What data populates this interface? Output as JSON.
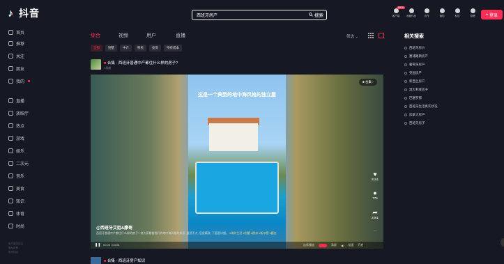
{
  "app": {
    "logo_text": "抖音"
  },
  "search": {
    "value": "西班牙房产",
    "button": "搜索"
  },
  "toolbar": {
    "items": [
      {
        "label": "客户端",
        "badge": "NEW"
      },
      {
        "label": "收藏作品"
      },
      {
        "label": "合作"
      },
      {
        "label": "通知"
      },
      {
        "label": "私信"
      },
      {
        "label": "投稿"
      }
    ],
    "login": "登录"
  },
  "sidebar": {
    "items": [
      {
        "label": "首页",
        "icon": "home-icon"
      },
      {
        "label": "推荐",
        "icon": "recommend-icon"
      },
      {
        "label": "关注",
        "icon": "follow-icon"
      },
      {
        "label": "朋友",
        "icon": "friends-icon"
      },
      {
        "label": "我的",
        "icon": "user-icon"
      },
      {
        "label": "直播",
        "icon": "live-icon"
      },
      {
        "label": "放映厅",
        "icon": "theater-icon"
      },
      {
        "label": "热点",
        "icon": "hot-icon"
      },
      {
        "label": "游戏",
        "icon": "game-icon"
      },
      {
        "label": "娱乐",
        "icon": "entertainment-icon"
      },
      {
        "label": "二次元",
        "icon": "anime-icon"
      },
      {
        "label": "音乐",
        "icon": "music-icon"
      },
      {
        "label": "美食",
        "icon": "food-icon"
      },
      {
        "label": "知识",
        "icon": "knowledge-icon"
      },
      {
        "label": "体育",
        "icon": "sports-icon"
      },
      {
        "label": "时尚",
        "icon": "fashion-icon"
      }
    ],
    "footer": [
      "用户服务协议",
      "隐私政策",
      "账号找回"
    ]
  },
  "tabs": [
    "综合",
    "视频",
    "用户",
    "直播"
  ],
  "filter_label": "筛选",
  "chips": [
    "全部",
    "别墅",
    "中介",
    "移民",
    "投资",
    "持有成本"
  ],
  "post": {
    "title": "合集 · 西班牙普通中产都住什么样的房子?",
    "date": "7月前",
    "overlay_text": "这是一个典型的地中海风格的独立屋",
    "collection": "合集",
    "author": "@西班牙艾姐&摩哥",
    "description": "西班牙普通中产都住什么样的房子? 带大家看看我们的地中海风格的新家, 虽然不大, 但很精致, 下面是详细。",
    "tags": [
      "#海外生活",
      "#别墅",
      "#欧洲",
      "#新冰雪",
      "#露台"
    ],
    "likes": "9151",
    "comments": "775",
    "shares": "2461",
    "more": "...",
    "time": "00:00 / 04:08",
    "controls": [
      "连续播放",
      "清屏",
      "倍速",
      "开启"
    ]
  },
  "next_post": {
    "title": "合集 · 西班牙房产知识"
  },
  "related": {
    "title": "相关搜索",
    "items": [
      "西班牙房价",
      "塞浦路斯房产",
      "葡萄牙房产",
      "英国房产",
      "新西兰房产",
      "澳大利亚房子",
      "巴塞罗那",
      "西班牙生活真实状况",
      "加拿大房产",
      "西班牙房子"
    ]
  },
  "colors": {
    "accent": "#fe2c55",
    "background": "#161823"
  }
}
